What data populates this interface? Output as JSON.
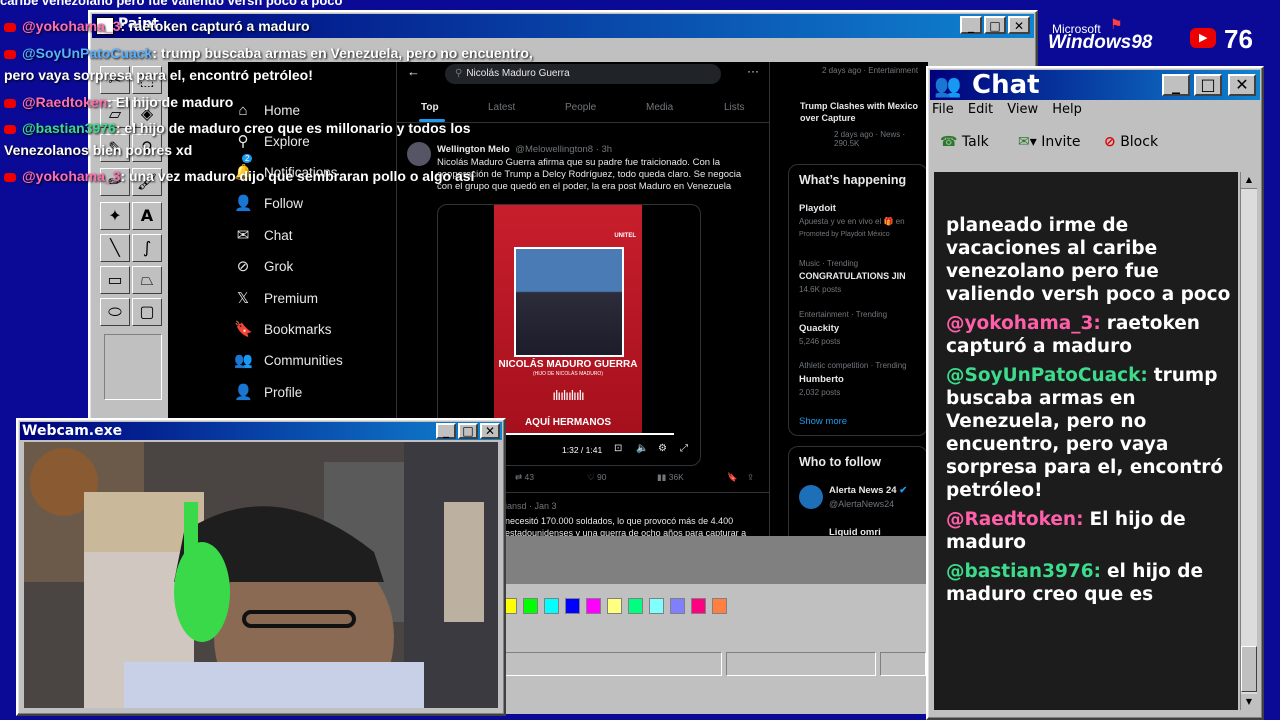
{
  "ticker_top": "caribe venezolano pero fue valiendo versh poco a poco",
  "paint": {
    "title": "Paint"
  },
  "palette_colors": [
    "#ffff00",
    "#00ff00",
    "#00ffff",
    "#0000ff",
    "#ff00ff",
    "#ffff80",
    "#00ff80",
    "#80ffff",
    "#8080ff",
    "#ff0080",
    "#ff8040"
  ],
  "x": {
    "search_value": "Nicolás Maduro Guerra",
    "tabs": [
      "Top",
      "Latest",
      "People",
      "Media",
      "Lists"
    ],
    "nav": [
      "Home",
      "Explore",
      "Notifications",
      "Follow",
      "Chat",
      "Grok",
      "Premium",
      "Bookmarks",
      "Communities",
      "Profile"
    ],
    "notif_badge": "2",
    "tweet": {
      "author": "Wellington Melo",
      "handle": "@Melowellington8 · 3h",
      "text": "Nicolás Maduro Guerra afirma que su padre fue traicionado. Con la cooperación de Trump a Delcy Rodríguez, todo queda claro. Se negocia con el grupo que quedó en el poder, la era post Maduro en Venezuela",
      "video_brand": "UNITEL",
      "video_name": "NICOLÁS MADURO GUERRA",
      "video_sub": "(HIJO DE NICOLÁS MADURO)",
      "video_footer": "AQUÍ HERMANOS",
      "video_time": "1:32 / 1:41",
      "replies": "43",
      "likes": "90",
      "views": "36K"
    },
    "tweet2": {
      "handle": "iansd · Jan 3",
      "text": "necesitó 170.000 soldados, lo que provocó más de 4.400 estadounidenses y una guerra de ocho años para capturar a"
    },
    "right": {
      "news_meta_top": "2 days ago · Entertainment",
      "news_title": "Trump Clashes with Mexico over Capture",
      "news_meta": "2 days ago · News · 290.5K",
      "happening_title": "What’s happening",
      "promo_title": "Playdoit",
      "promo_text": "Apuesta y ve en vivo el 🎁 en",
      "promo_by": "Promoted by Playdoit México",
      "trends": [
        {
          "meta": "Music · Trending",
          "title": "CONGRATULATIONS JIN",
          "count": "14.6K posts"
        },
        {
          "meta": "Entertainment · Trending",
          "title": "Quackity",
          "count": "5,246 posts"
        },
        {
          "meta": "Athletic competition · Trending",
          "title": "Humberto",
          "count": "2,032 posts"
        }
      ],
      "show_more": "Show more",
      "who_to_follow": "Who to follow",
      "follow_name": "Alerta News 24",
      "follow_handle": "@AlertaNews24",
      "follow_next": "Liquid omri"
    }
  },
  "webcam": {
    "title": "Webcam.exe"
  },
  "chat": {
    "title": "Chat",
    "menu": [
      "File",
      "Edit",
      "View",
      "Help"
    ],
    "tools": [
      "Talk",
      "Invite",
      "Block"
    ],
    "messages": [
      {
        "user": "",
        "user_color": "#ffffff",
        "text": "planeado irme de vacaciones al caribe venezolano pero fue valiendo versh poco a poco"
      },
      {
        "user": "@yokohama_3:",
        "user_color": "#ff5fa8",
        "text": "raetoken capturó a maduro"
      },
      {
        "user": "@SoyUnPatoCuack:",
        "user_color": "#3cdc8c",
        "text": "trump buscaba armas en Venezuela, pero no encuentro, pero vaya sorpresa para el, encontró petróleo!"
      },
      {
        "user": "@Raedtoken:",
        "user_color": "#ff5fa8",
        "text": "El hijo de maduro"
      },
      {
        "user": "@bastian3976:",
        "user_color": "#3cdc8c",
        "text": "el hijo de maduro creo que es"
      }
    ]
  },
  "brand": {
    "microsoft": "Microsoft",
    "windows": "Windows98"
  },
  "youtube_viewers": "76",
  "overlay": [
    {
      "user": "@yokohama_3",
      "user_color": "#ff6fb0",
      "text": ": raetoken capturó a maduro"
    },
    {
      "user": "@SoyUnPatoCuack",
      "user_color": "#58b0ff",
      "text": ": trump buscaba armas en Venezuela, pero no encuentro,"
    },
    {
      "user": "",
      "user_color": "#ffffff",
      "text": "pero vaya sorpresa para el, encontró petróleo!"
    },
    {
      "user": "@Raedtoken",
      "user_color": "#ff6fb0",
      "text": ": El hijo de maduro"
    },
    {
      "user": "@bastian3976",
      "user_color": "#3cdc8c",
      "text": ": el hijo de maduro creo que es millonario y todos los"
    },
    {
      "user": "",
      "user_color": "#ffffff",
      "text": "Venezolanos bien pobres xd"
    },
    {
      "user": "@yokohama_3",
      "user_color": "#ff6fb0",
      "text": ": una vez maduro dijo que sembraran pollo o algo así"
    }
  ]
}
